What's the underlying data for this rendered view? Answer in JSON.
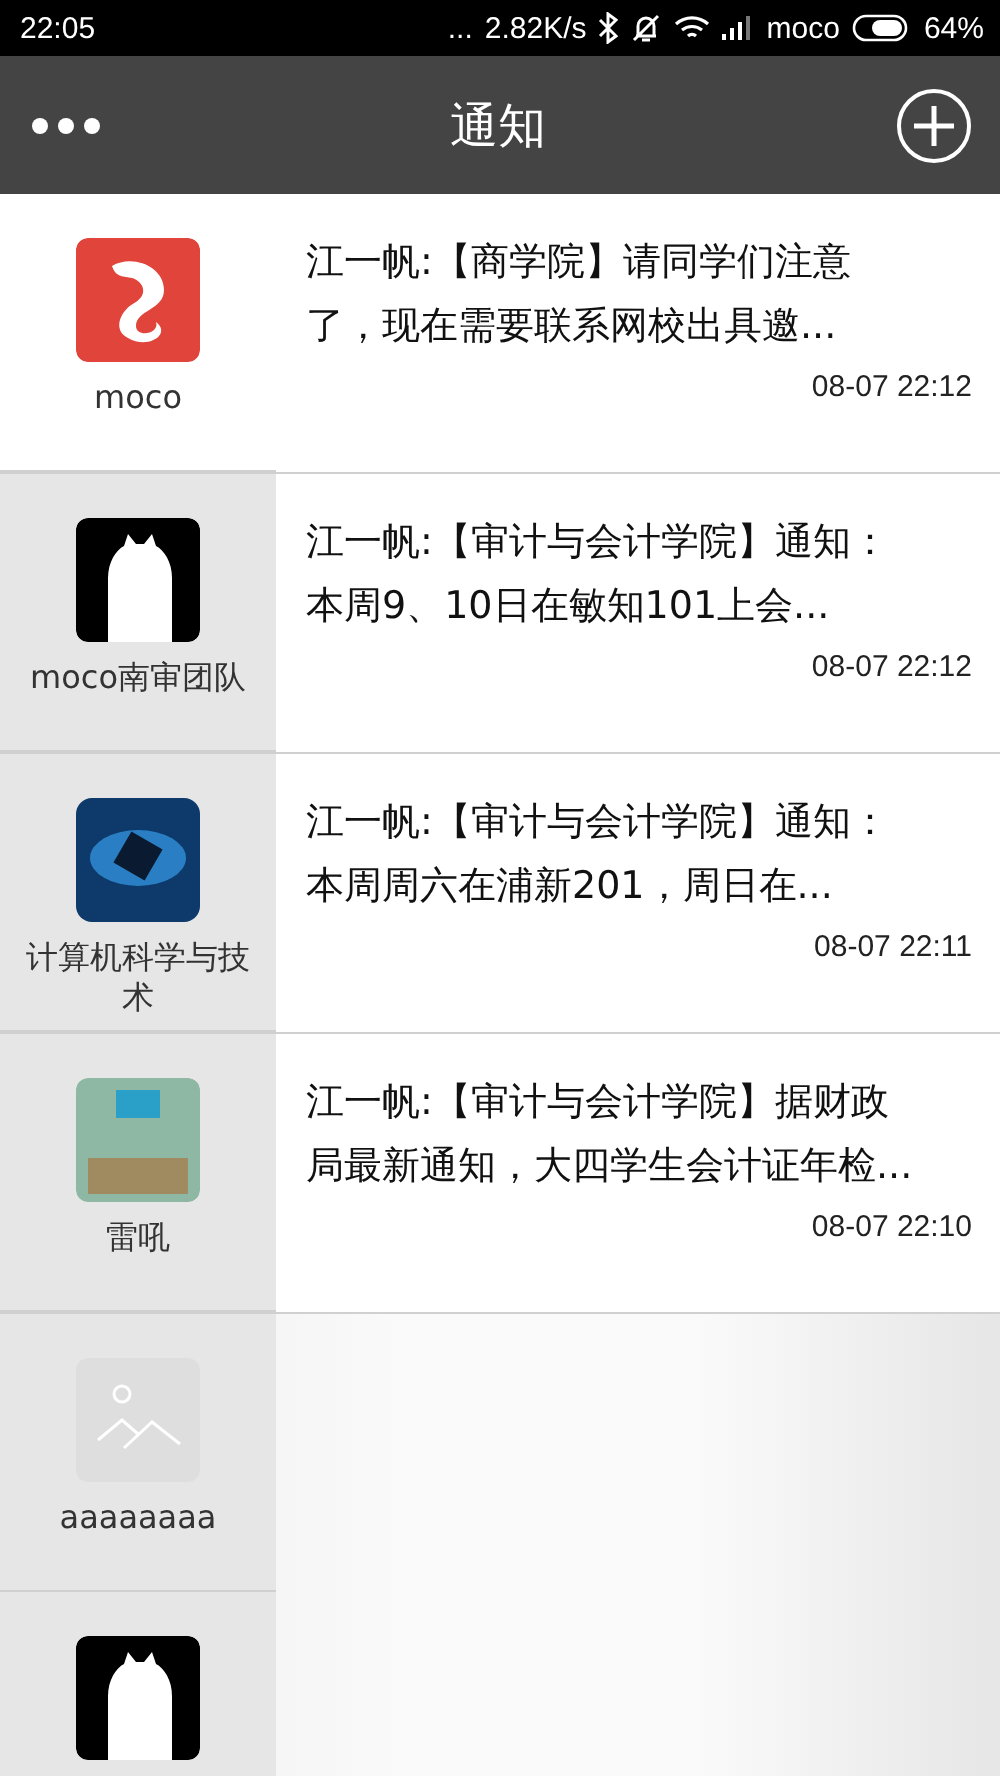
{
  "status_bar": {
    "time": "22:05",
    "more": "...",
    "speed": "2.82K/s",
    "carrier": "moco",
    "battery": "64%"
  },
  "header": {
    "title": "通知"
  },
  "contacts": [
    {
      "name": "moco",
      "kind": "logo",
      "selected": true,
      "message": "江一帆:【商学院】请同学们注意了，现在需要联系网校出具邀...",
      "time": "08-07 22:12"
    },
    {
      "name": "moco南审团队",
      "kind": "cartoon",
      "selected": false,
      "message": "江一帆:【审计与会计学院】通知：本周9、10日在敏知101上会...",
      "time": "08-07 22:12"
    },
    {
      "name": "计算机科学与技术",
      "kind": "emblem",
      "selected": false,
      "message": "江一帆:【审计与会计学院】通知：本周周六在浦新201，周日在...",
      "time": "08-07 22:11"
    },
    {
      "name": "雷吼",
      "kind": "photo",
      "selected": false,
      "message": "江一帆:【审计与会计学院】据财政局最新通知，大四学生会计证年检...",
      "time": "08-07 22:10"
    },
    {
      "name": "aaaaaaaa",
      "kind": "placeholder",
      "selected": false
    },
    {
      "kind": "cartoon",
      "selected": false
    }
  ]
}
